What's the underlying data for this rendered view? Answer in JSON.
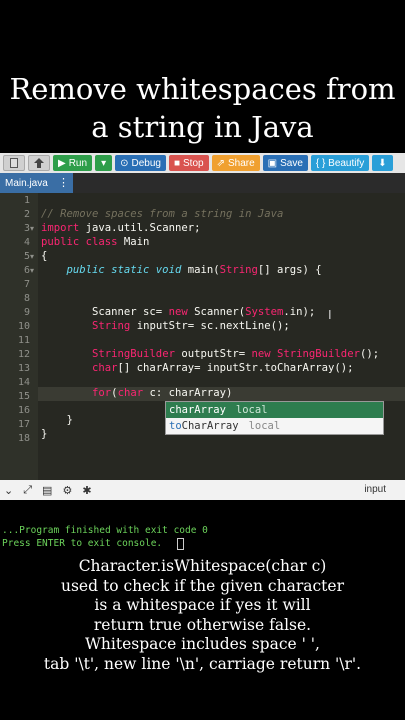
{
  "title": {
    "line1": "Remove whitespaces from",
    "line2": "a string in Java"
  },
  "toolbar": {
    "run_label": "Run",
    "debug_label": "Debug",
    "stop_label": "Stop",
    "share_label": "Share",
    "save_label": "Save",
    "beautify_label": "{ } Beautify"
  },
  "tab": {
    "filename": "Main.java",
    "menu_glyph": "⋮"
  },
  "editor": {
    "line_numbers": [
      "1",
      "2",
      "3",
      "4",
      "5",
      "6",
      "7",
      "8",
      "9",
      "10",
      "11",
      "12",
      "13",
      "14",
      "15",
      "16",
      "17",
      "18"
    ],
    "lines": {
      "l2_comment": "// Remove spaces from a string in Java",
      "l3_kw": "import",
      "l3_rest": " java.util.Scanner;",
      "l4_kw": "public class",
      "l4_rest": " Main",
      "l5": "{",
      "l6_pre": "    ",
      "l6_kw": "public static void",
      "l6_mid": " main(",
      "l6_type": "String",
      "l6_post": "[] args) {",
      "l9_pre": "        Scanner sc= ",
      "l9_kw": "new",
      "l9_sp": " ",
      "l9_cls": "Scanner(",
      "l9_type": "System",
      "l9_post": ".in);",
      "l10_pre": "        ",
      "l10_type": "String",
      "l10_post": " inputStr= sc.nextLine();",
      "l12_pre": "        ",
      "l12_type": "StringBuilder",
      "l12_mid": " outputStr= ",
      "l12_kw": "new",
      "l12_sp": " ",
      "l12_cls": "StringBuilder",
      "l12_post": "();",
      "l13_pre": "        ",
      "l13_kw": "char",
      "l13_post": "[] charArray= inputStr.toCharArray();",
      "l15_pre": "        ",
      "l15_kw": "for",
      "l15_mid": "(",
      "l15_kw2": "char",
      "l15_post": " c: charArray)",
      "l17": "    }",
      "l18": "}"
    },
    "autocomplete": [
      {
        "match": "charArray",
        "rest": "",
        "meta": "local"
      },
      {
        "match": "to",
        "rest": "CharArray",
        "meta": "local"
      }
    ]
  },
  "output": {
    "label": "input"
  },
  "console": {
    "line1": "...Program finished with exit code 0",
    "line2": "Press ENTER to exit console."
  },
  "explanation": [
    "Character.isWhitespace(char c)",
    "used to check if the given character",
    "is a whitespace if yes it will",
    "return true otherwise false.",
    "Whitespace includes space ' ',",
    "tab '\\t', new line '\\n', carriage return '\\r'."
  ],
  "colors": {
    "run": "#2e9e4a",
    "debug": "#2a6fb5",
    "stop": "#d9534f",
    "share": "#f0a030",
    "save": "#2a6fb5",
    "beautify": "#2a9fd8",
    "editor_bg": "#272822",
    "console_text": "#6cd35b"
  }
}
